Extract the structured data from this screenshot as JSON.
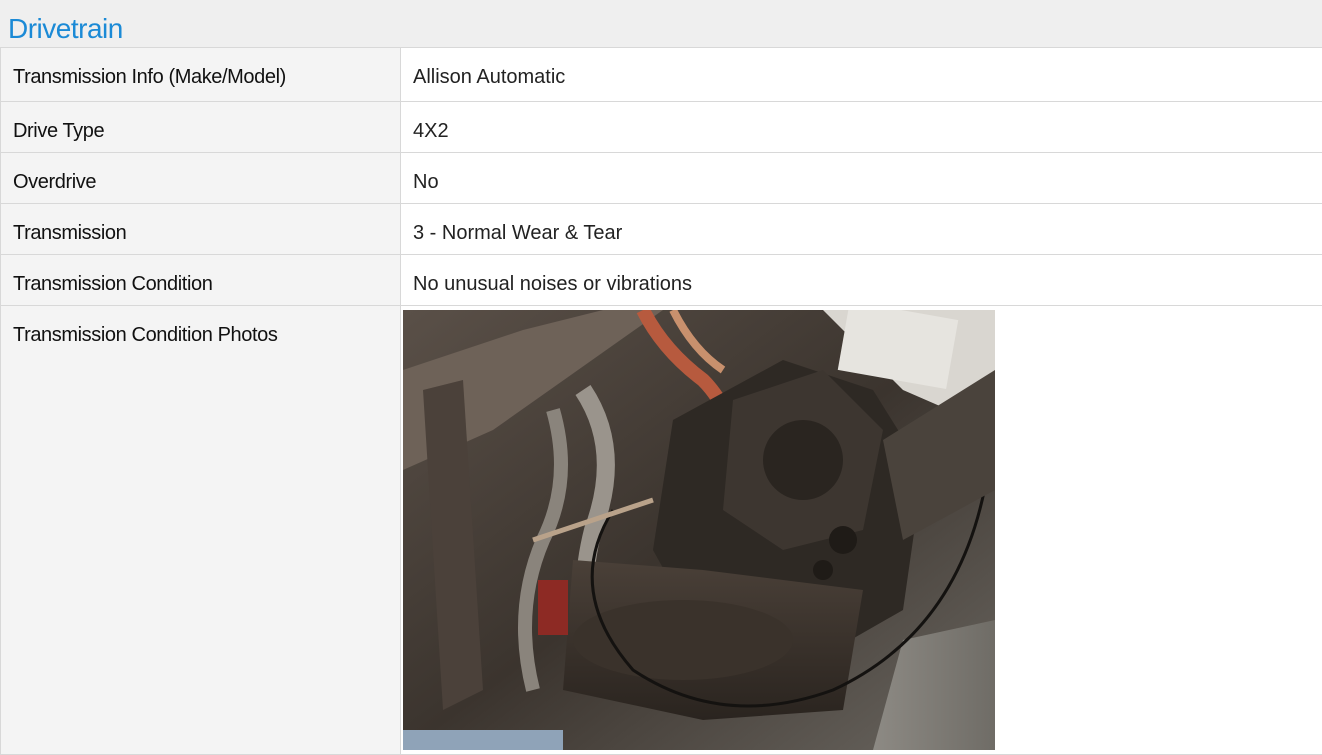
{
  "section": {
    "title": "Drivetrain"
  },
  "rows": [
    {
      "label": "Transmission Info (Make/Model)",
      "value": "Allison Automatic"
    },
    {
      "label": "Drive Type",
      "value": "4X2"
    },
    {
      "label": "Overdrive",
      "value": "No"
    },
    {
      "label": "Transmission",
      "value": "3 - Normal Wear & Tear"
    },
    {
      "label": "Transmission Condition",
      "value": "No unusual noises or vibrations"
    }
  ],
  "photo_row": {
    "label": "Transmission Condition Photos",
    "photo_subject": "undercarriage transmission photo"
  },
  "colors": {
    "title": "#1b8ad6",
    "label_bg": "#f4f4f4",
    "value_bg": "#ffffff",
    "border": "#d8d8d8",
    "page_bg": "#efefef"
  }
}
